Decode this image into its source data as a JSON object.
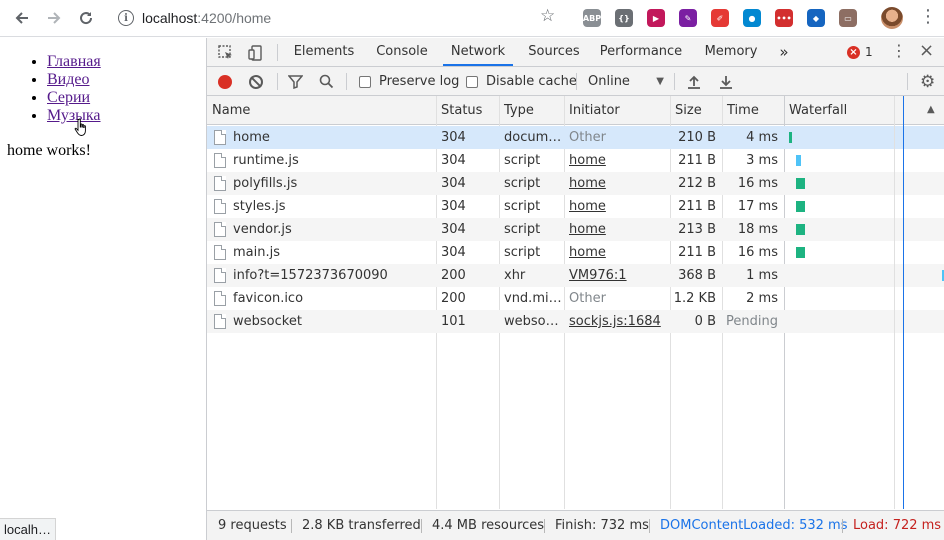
{
  "browser": {
    "url_host": "localhost",
    "url_rest": ":4200/home",
    "extensions": [
      {
        "name": "abp-extension-icon",
        "label": "ABP",
        "color": "#8a8f94"
      },
      {
        "name": "code-extension-icon",
        "label": "{}",
        "color": "#6b6f74"
      },
      {
        "name": "media-extension-icon",
        "label": "▶",
        "color": "#c2185b"
      },
      {
        "name": "feather-extension-icon",
        "label": "✎",
        "color": "#7b1fa2"
      },
      {
        "name": "pen-extension-icon",
        "label": "✐",
        "color": "#e53935"
      },
      {
        "name": "circle-extension-icon",
        "label": "●",
        "color": "#0288d1"
      },
      {
        "name": "dots-extension-icon",
        "label": "•••",
        "color": "#d32f2f"
      },
      {
        "name": "flame-extension-icon",
        "label": "◆",
        "color": "#1565c0"
      },
      {
        "name": "screen-extension-icon",
        "label": "▭",
        "color": "#8d6e63"
      }
    ]
  },
  "page": {
    "nav": [
      "Главная",
      "Видео",
      "Серии",
      "Музыка"
    ],
    "content": "home works!",
    "status_url": "localh…"
  },
  "devtools": {
    "tabs": [
      "Elements",
      "Console",
      "Network",
      "Sources",
      "Performance",
      "Memory"
    ],
    "active_tab": "Network",
    "more_tabs": "»",
    "error_count": "1",
    "toolbar": {
      "preserve_log": "Preserve log",
      "disable_cache": "Disable cache",
      "throttling": "Online"
    },
    "columns": [
      "Name",
      "Status",
      "Type",
      "Initiator",
      "Size",
      "Time",
      "Waterfall"
    ],
    "rows": [
      {
        "name": "home",
        "status": "304",
        "type": "docum…",
        "initiator": "Other",
        "initiator_link": false,
        "size": "210 B",
        "time": "4 ms"
      },
      {
        "name": "runtime.js",
        "status": "304",
        "type": "script",
        "initiator": "home",
        "initiator_link": true,
        "size": "211 B",
        "time": "3 ms"
      },
      {
        "name": "polyfills.js",
        "status": "304",
        "type": "script",
        "initiator": "home",
        "initiator_link": true,
        "size": "212 B",
        "time": "16 ms"
      },
      {
        "name": "styles.js",
        "status": "304",
        "type": "script",
        "initiator": "home",
        "initiator_link": true,
        "size": "211 B",
        "time": "17 ms"
      },
      {
        "name": "vendor.js",
        "status": "304",
        "type": "script",
        "initiator": "home",
        "initiator_link": true,
        "size": "213 B",
        "time": "18 ms"
      },
      {
        "name": "main.js",
        "status": "304",
        "type": "script",
        "initiator": "home",
        "initiator_link": true,
        "size": "211 B",
        "time": "16 ms"
      },
      {
        "name": "info?t=1572373670090",
        "status": "200",
        "type": "xhr",
        "initiator": "VM976:1",
        "initiator_link": true,
        "size": "368 B",
        "time": "1 ms"
      },
      {
        "name": "favicon.ico",
        "status": "200",
        "type": "vnd.mi…",
        "initiator": "Other",
        "initiator_link": false,
        "size": "1.2 KB",
        "time": "2 ms"
      },
      {
        "name": "websocket",
        "status": "101",
        "type": "webso…",
        "initiator": "sockjs.js:1684",
        "initiator_link": true,
        "size": "0 B",
        "time": "Pending"
      }
    ],
    "summary": {
      "requests": "9 requests",
      "transferred": "2.8 KB transferred",
      "resources": "4.4 MB resources",
      "finish": "Finish: 732 ms",
      "dom_content_loaded": "DOMContentLoaded: 532 ms",
      "load": "Load: 722 ms"
    },
    "colors": {
      "accent": "#1a73e8",
      "record": "#d93025",
      "dcl": "#1a73e8",
      "load": "#c5221f",
      "waterfall_bar": "#1db381"
    }
  }
}
